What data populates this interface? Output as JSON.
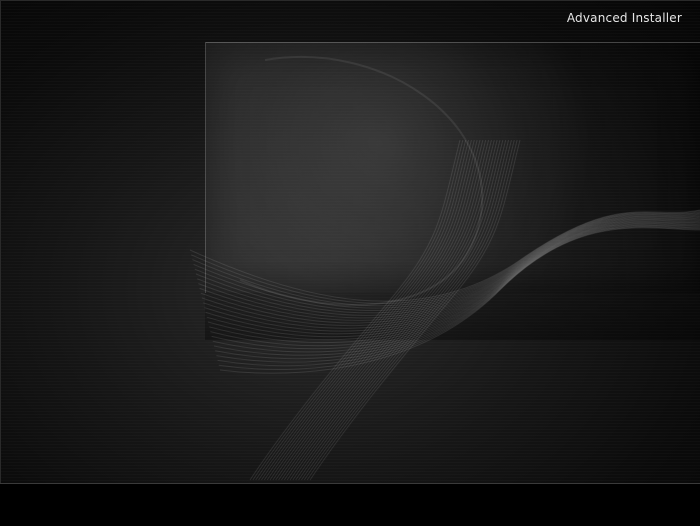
{
  "app": {
    "brand_text": "Advanced Installer"
  },
  "colors": {
    "background": "#050505",
    "panel_tint": "#2a2a2a",
    "brand_text": "#e6e6e6",
    "bottom_bar": "#000000"
  }
}
